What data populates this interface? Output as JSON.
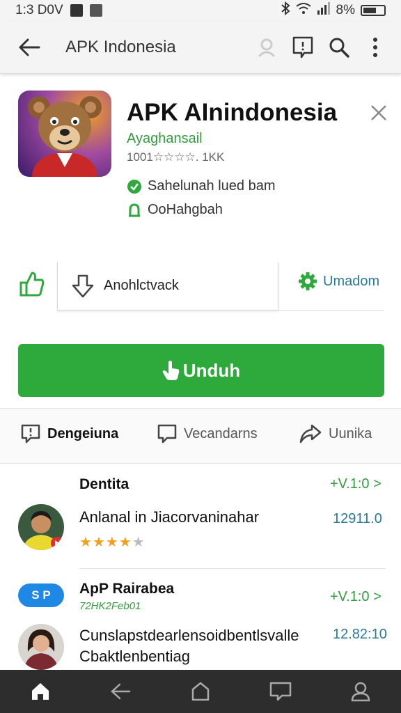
{
  "status_bar": {
    "time": "1:3 D0V",
    "battery": "8%"
  },
  "app_bar": {
    "title": "APK Indonesia"
  },
  "app": {
    "name": "APK AInindonesia",
    "developer": "Ayaghansail",
    "rating": "1001☆☆☆☆. 1KK",
    "badge1": "Sahelunah lued bam",
    "badge2": "OoHahgbah"
  },
  "actions": {
    "download_label": "Anohlctvack",
    "settings_label": "Umadom"
  },
  "main_button": {
    "label": "Unduh"
  },
  "tabs": [
    {
      "label": "Dengeiuna"
    },
    {
      "label": "Vecandarns"
    },
    {
      "label": "Uunika"
    }
  ],
  "reviews_section": {
    "title": "Dentita",
    "version": "+V.1:0 >"
  },
  "review1": {
    "text": "Anlanal in Jiacorvaninahar",
    "number": "12911.0",
    "stars": 4
  },
  "app2": {
    "tag": "S P",
    "title": "ApP Rairabea",
    "subtitle": "72HK2Feb01",
    "version": "+V.1:0 >"
  },
  "review2": {
    "line1": "Cunslapstdearlensoidbentlsvalle",
    "line2": "Cbaktlenbentiag",
    "number": "12.82:10"
  },
  "colors": {
    "accent_green": "#2eaa3c",
    "link_blue": "#2a7a9a",
    "tag_blue": "#1e88e5",
    "star": "#f0a020"
  }
}
